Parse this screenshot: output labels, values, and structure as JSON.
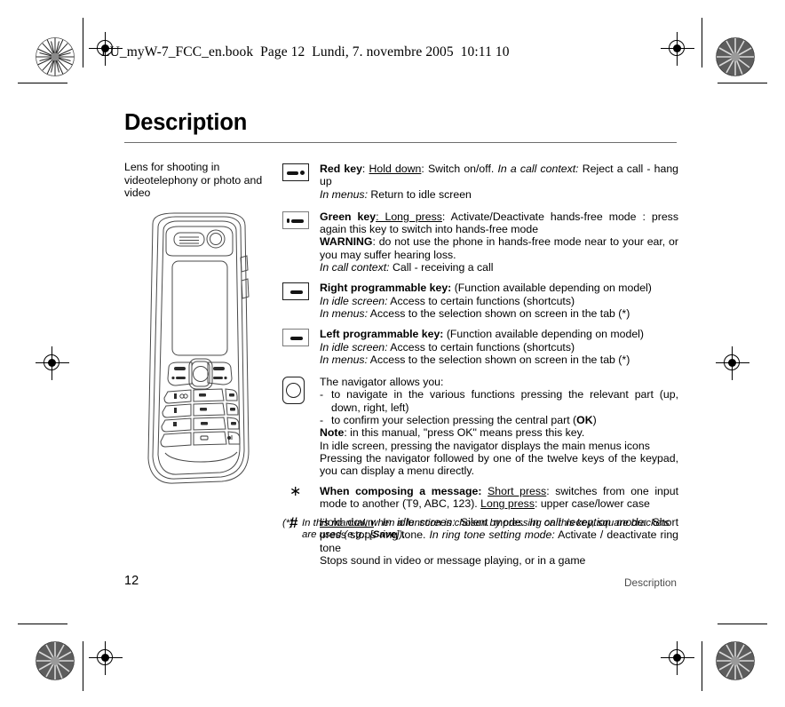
{
  "header": {
    "book_line": "LU_myW-7_FCC_en.book  Page 12  Lundi, 7. novembre 2005  10:11 10"
  },
  "document": {
    "title": "Description",
    "lens_caption": "Lens for shooting in videotelephony or photo and video"
  },
  "key_rows": [
    {
      "icon": "red-key-icon",
      "name": "red-key",
      "lines_html": "<b>Red key</b>: <u>Hold down</u>: Switch on/off. <i>In a call context:</i> Reject a call - hang up<br><i>In menus:</i> Return to idle screen"
    },
    {
      "icon": "green-key-icon",
      "name": "green-key",
      "lines_html": "<b>Green key</b><u>: Long press</u>: Activate/Deactivate hands-free mode : press again this key to switch into hands-free mode<br><b>WARNING</b>: do not use the phone in hands-free mode near to your ear, or you may suffer hearing loss.<br><i>In call context:</i> Call - receiving a call"
    },
    {
      "icon": "right-programmable-key-icon",
      "name": "right-programmable-key",
      "lines_html": "<b>Right programmable key:</b> (Function available depending on model)<br><i>In idle screen:</i> Access to certain functions (shortcuts)<br><i>In menus:</i> Access to the selection shown on screen in the tab (*)"
    },
    {
      "icon": "left-programmable-key-icon",
      "name": "left-programmable-key",
      "lines_html": "<b>Left programmable key:</b> (Function available depending on model)<br><i>In idle screen:</i> Access to certain functions (shortcuts)<br><i>In menus:</i> Access to the selection shown on screen in the tab (*)"
    }
  ],
  "navigator": {
    "icon": "navigator-key-icon",
    "intro": "The navigator allows you:",
    "bullets": [
      "to navigate in the various functions pressing the relevant part (up, down, right, left)",
      "to confirm your selection pressing the central part (OK)"
    ],
    "bullet_marker": "-",
    "notes_html": "<b>Note</b>: in this manual, \"press OK\" means press this key.<br>In idle screen, pressing the navigator displays the main menus icons<br>Pressing the navigator followed by one of the twelve keys of the keypad, you can display a menu directly."
  },
  "symbol_rows": [
    {
      "symbol": "∗",
      "name": "star-key",
      "lines_html": "<b>When composing a message:</b> <u>Short press</u>: switches from one input mode to another (T9, ABC, 123). <u>Long press</u>: upper case/lower case"
    },
    {
      "symbol": "#",
      "name": "hash-key",
      "lines_html": "<u>Hold down</u>: <i>In idle screen:</i> Silent mode. <i>In call reception mode:</i> Short press stops ring tone. <i>In ring tone setting mode:</i> Activate / deactivate ring tone<br>Stops sound in video or message playing, or in a game"
    }
  ],
  "footnote": {
    "mark": "(*)",
    "text_html": "In this manual, when a function is chosen by pressing on this key, square brackets are used (e.g.: [<b>Save</b>])."
  },
  "footer": {
    "page_number": "12",
    "section": "Description"
  },
  "colors": {
    "text": "#000000",
    "rule": "#6e6e6e",
    "footer_section": "#4c4c4c",
    "art_stroke": "#4a4a4a"
  }
}
